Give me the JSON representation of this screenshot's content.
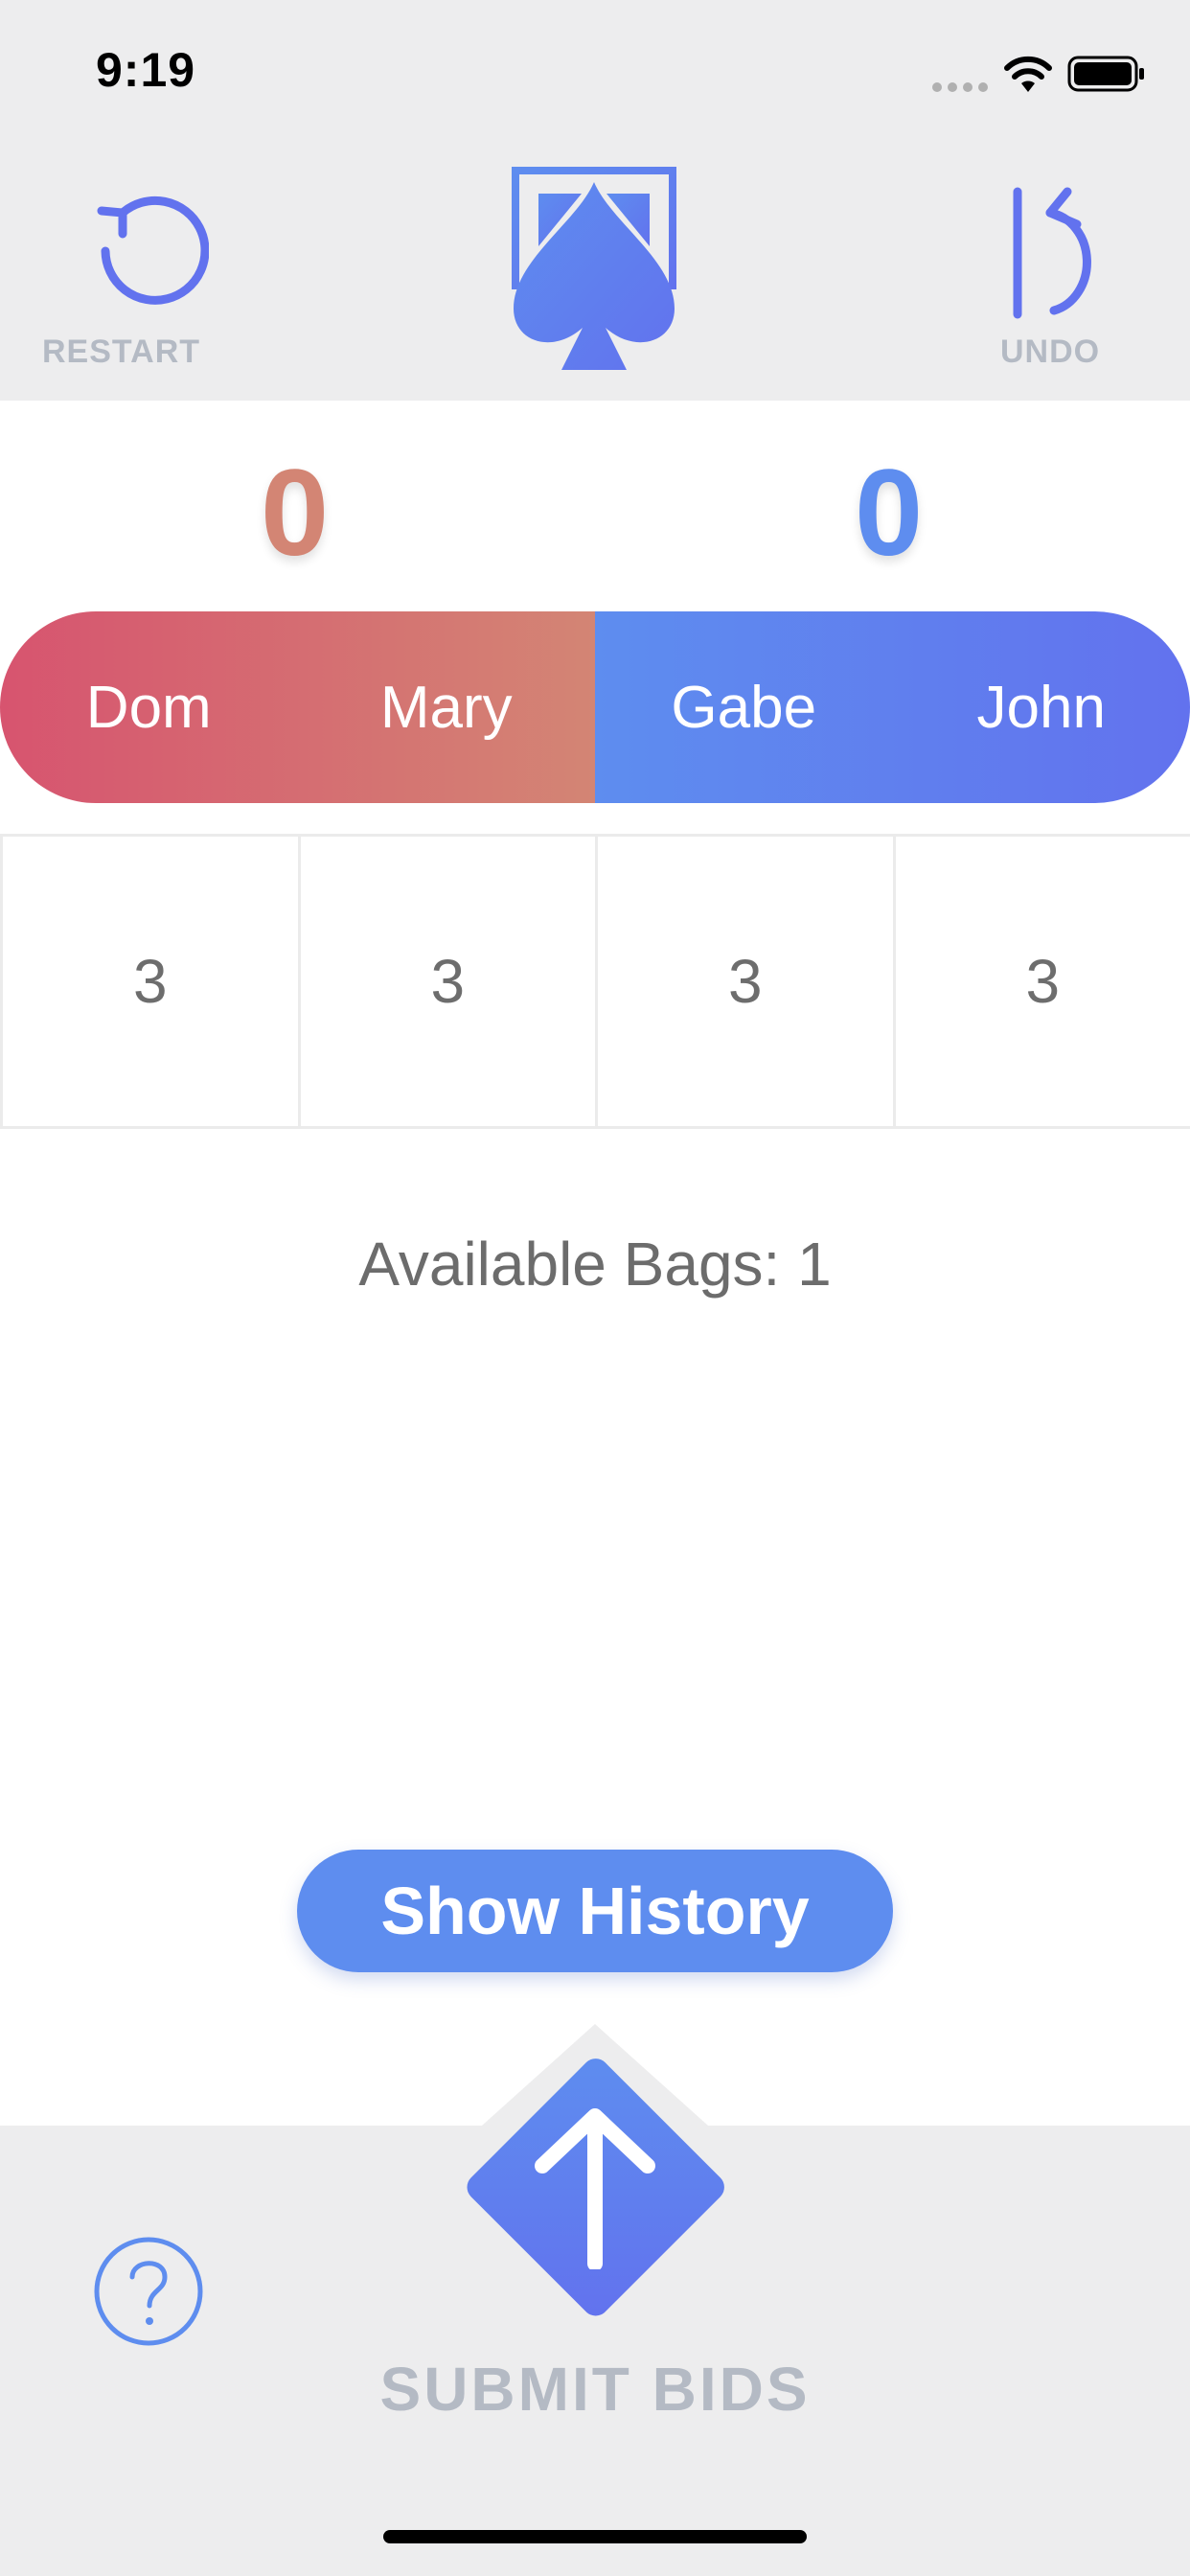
{
  "status_bar": {
    "time": "9:19"
  },
  "header": {
    "restart_label": "RESTART",
    "undo_label": "UNDO",
    "accent_color": "#6272ee",
    "logo_icon": "spade-card-icon"
  },
  "scores": {
    "team1": "0",
    "team2": "0",
    "team1_color": "#d38574",
    "team2_color": "#5e8def"
  },
  "teams": {
    "team1_players": [
      "Dom",
      "Mary"
    ],
    "team2_players": [
      "Gabe",
      "John"
    ]
  },
  "bids": [
    "3",
    "3",
    "3",
    "3"
  ],
  "bags_text": "Available Bags: 1",
  "show_history_label": "Show History",
  "submit_label": "SUBMIT BIDS",
  "help_icon": "question-icon"
}
